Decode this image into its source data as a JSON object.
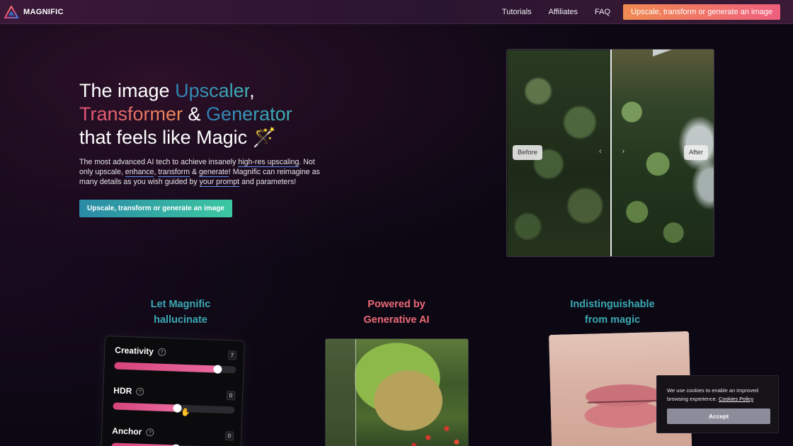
{
  "nav": {
    "logo_text": "MAGNIFIC",
    "links": [
      "Tutorials",
      "Affiliates",
      "FAQ"
    ],
    "cta": "Upscale, transform or generate an image"
  },
  "hero": {
    "line1_a": "The image ",
    "line1_b": "Upscaler",
    "line1_c": ",",
    "line2_a": "Transformer",
    "line2_b": " & ",
    "line2_c": "Generator",
    "line3": "that feels like Magic",
    "line3_emoji": "🪄",
    "desc_1": "The most advanced AI tech to achieve insanely ",
    "desc_link1": "high-res upscaling",
    "desc_2": ". Not only upscale, ",
    "desc_link2": "enhance",
    "desc_3": ", ",
    "desc_link3": "transform",
    "desc_4": " & ",
    "desc_link4": "generate",
    "desc_5": "! Magnific can reimagine as many details as you wish guided by ",
    "desc_link5": "your prompt",
    "desc_6": " and parameters!",
    "cta": "Upscale, transform or generate an image"
  },
  "compare": {
    "before": "Before",
    "after": "After",
    "arrow_left": "‹",
    "arrow_right": "›"
  },
  "features": [
    {
      "line1": "Let Magnific",
      "line2": "hallucinate"
    },
    {
      "line1": "Powered by",
      "line2": "Generative AI"
    },
    {
      "line1": "Indistinguishable",
      "line2": "from magic"
    }
  ],
  "sliders": [
    {
      "label": "Creativity",
      "value": "7",
      "fraction": 0.85
    },
    {
      "label": "HDR",
      "value": "0",
      "fraction": 0.53
    },
    {
      "label": "Anchor",
      "value": "0",
      "fraction": 0.53
    }
  ],
  "help_glyph": "?",
  "cookie": {
    "text": "We use cookies to enable an improved browsing experience. ",
    "link": "Cookies Policy",
    "button": "Accept"
  },
  "colors": {
    "accent_teal": "#3aa9b3",
    "accent_pink": "#ec6a78",
    "nav_cta": "#ef6f6a",
    "slider_fill": "#d6447a"
  }
}
